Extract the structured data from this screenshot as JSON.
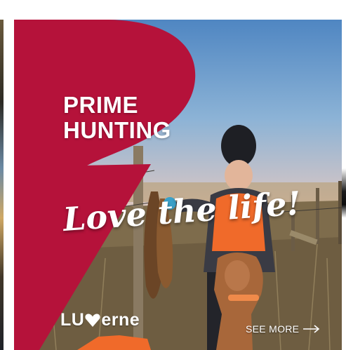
{
  "ad": {
    "headline_line1": "PRIME",
    "headline_line2": "HUNTING",
    "tagline": "Love the life!",
    "brand_part1": "LU",
    "brand_part2": "erne",
    "see_more_label": "SEE MORE",
    "brand_color": "#B5123A",
    "icons": [
      "heart-v-icon",
      "arrow-right-icon"
    ]
  }
}
